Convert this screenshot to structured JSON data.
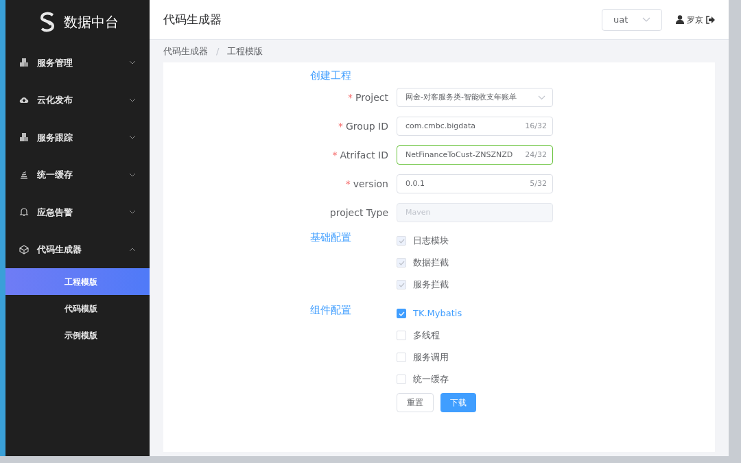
{
  "sidebar": {
    "logo_text": "数据中台",
    "items": [
      {
        "label": "服务管理",
        "expanded": false
      },
      {
        "label": "云化发布",
        "expanded": false
      },
      {
        "label": "服务跟踪",
        "expanded": false
      },
      {
        "label": "统一缓存",
        "expanded": false
      },
      {
        "label": "应急告警",
        "expanded": false
      },
      {
        "label": "代码生成器",
        "expanded": true,
        "children": [
          {
            "label": "工程模版",
            "selected": true
          },
          {
            "label": "代码模版",
            "selected": false
          },
          {
            "label": "示例模版",
            "selected": false
          }
        ]
      }
    ]
  },
  "header": {
    "title": "代码生成器",
    "env_select": {
      "value": "uat"
    },
    "user": "罗京"
  },
  "breadcrumb": {
    "separator": "/",
    "items": [
      "代码生成器",
      "工程模版"
    ]
  },
  "sections": [
    {
      "title": "创建工程",
      "fields": [
        {
          "kind": "select",
          "label": "Project",
          "required_mark": "*",
          "value": "网金-对客服务类-智能收支年账单"
        },
        {
          "kind": "input",
          "label": "Group ID",
          "required_mark": "*",
          "value": "com.cmbc.bigdata",
          "count": "16/32",
          "focused": false
        },
        {
          "kind": "input",
          "label": "Atrifact ID",
          "required_mark": "*",
          "value": "NetFinanceToCust-ZNSZNZD",
          "count": "24/32",
          "focused": true
        },
        {
          "kind": "input",
          "label": "version",
          "required_mark": "*",
          "value": "0.0.1",
          "count": "5/32",
          "focused": false
        },
        {
          "kind": "disabled",
          "label": "project Type",
          "placeholder": "Maven"
        }
      ]
    },
    {
      "title": "基础配置",
      "checkboxes": [
        {
          "label": "日志模块",
          "checked": true,
          "disabled": true
        },
        {
          "label": "数据拦截",
          "checked": true,
          "disabled": true
        },
        {
          "label": "服务拦截",
          "checked": true,
          "disabled": true
        }
      ]
    },
    {
      "title": "组件配置",
      "checkboxes": [
        {
          "label": "TK.Mybatis",
          "checked": true,
          "disabled": false
        },
        {
          "label": "多线程",
          "checked": false,
          "disabled": false
        },
        {
          "label": "服务调用",
          "checked": false,
          "disabled": false
        },
        {
          "label": "统一缓存",
          "checked": false,
          "disabled": false
        }
      ]
    }
  ],
  "buttons": [
    {
      "label": "重置",
      "primary": false
    },
    {
      "label": "下载",
      "primary": true
    }
  ]
}
